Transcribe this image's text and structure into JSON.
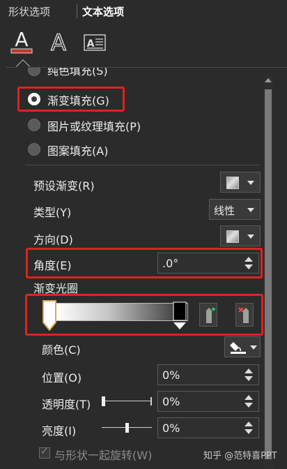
{
  "tabs": {
    "shape_options": "形状选项",
    "text_options": "文本选项"
  },
  "icons": {
    "text_fill": "text-fill-outline-icon",
    "text_effects": "text-effects-icon",
    "text_box": "text-box-icon"
  },
  "accent_colors": {
    "highlight": "#e0221e",
    "text_fill_underline": "#c0392b"
  },
  "fill_options": {
    "solid": "纯色填充(S)",
    "gradient": "渐变填充(G)",
    "picture": "图片或纹理填充(P)",
    "pattern": "图案填充(A)"
  },
  "gradient": {
    "preset_label": "预设渐变(R)",
    "type_label": "类型(Y)",
    "type_value": "线性",
    "direction_label": "方向(D)",
    "angle_label": "角度(E)",
    "angle_value": ".0°",
    "stops_label": "渐变光圈",
    "color_label": "颜色(C)",
    "position_label": "位置(O)",
    "position_value": "0%",
    "transparency_label": "透明度(T)",
    "transparency_value": "0%",
    "transparency_level": 0,
    "brightness_label": "亮度(I)",
    "brightness_value": "0%",
    "brightness_level": 0.5,
    "rotate_with_shape": "与形状一起旋转(W)"
  },
  "watermark": "知乎 @范特喜PPT"
}
